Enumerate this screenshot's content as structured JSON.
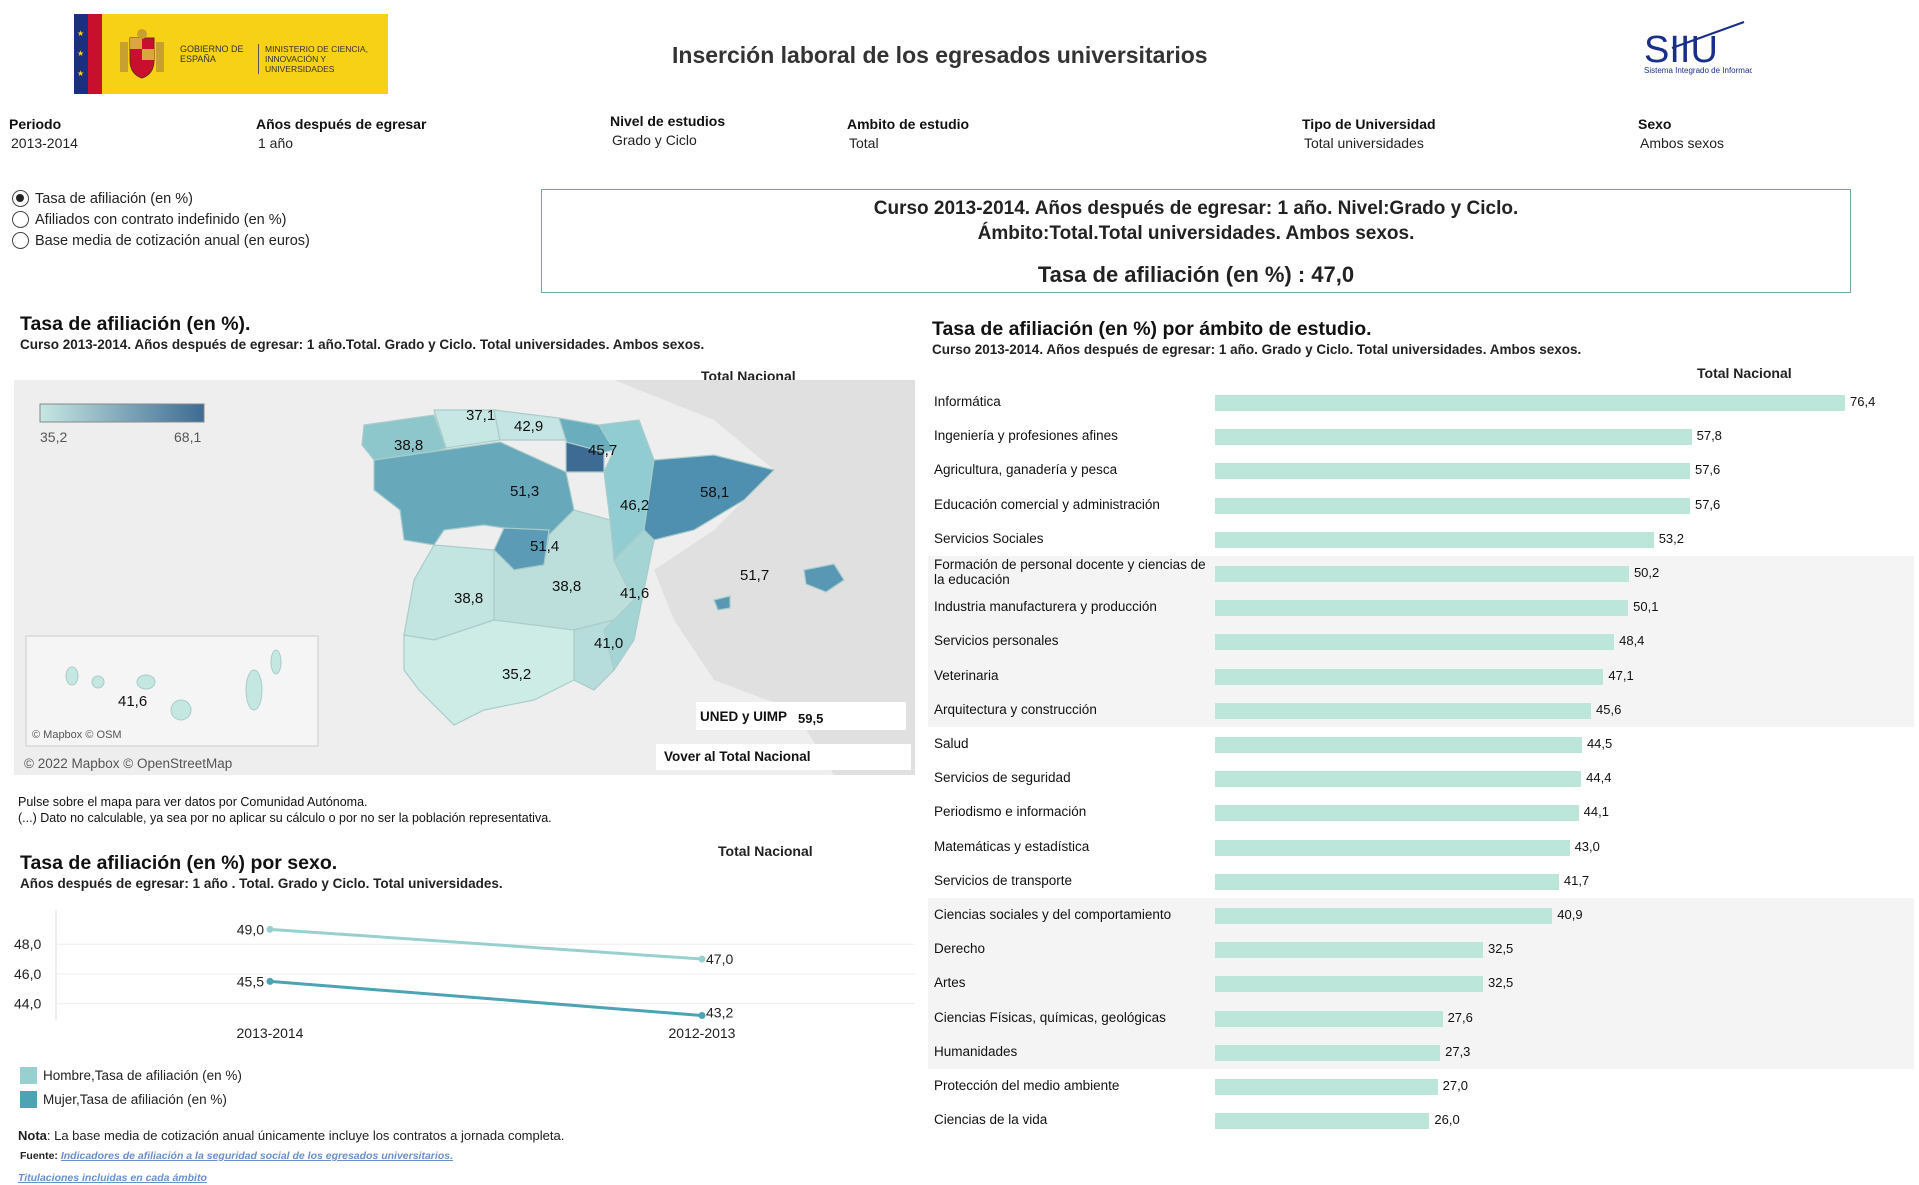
{
  "header": {
    "logo_gov_text": "GOBIERNO DE ESPAÑA",
    "logo_ministry_text": "MINISTERIO DE CIENCIA, INNOVACIÓN Y UNIVERSIDADES",
    "title": "Inserción laboral de los egresados universitarios",
    "siiu_logo": "SIIU",
    "siiu_sub": "Sistema Integrado de Información Universitaria"
  },
  "filters": [
    {
      "label": "Periodo",
      "value": "2013-2014"
    },
    {
      "label": "Años después de egresar",
      "value": "1 año"
    },
    {
      "label": "Nivel de estudios",
      "value": "Grado y Ciclo"
    },
    {
      "label": "Ambito de estudio",
      "value": "Total"
    },
    {
      "label": "Tipo de Universidad",
      "value": "Total universidades"
    },
    {
      "label": "Sexo",
      "value": "Ambos sexos"
    }
  ],
  "metric_options": [
    {
      "label": "Tasa de afiliación (en %)",
      "selected": true
    },
    {
      "label": "Afiliados con contrato indefinido (en %)",
      "selected": false
    },
    {
      "label": "Base media de cotización anual (en euros)",
      "selected": false
    }
  ],
  "summary": {
    "line1": "Curso 2013-2014. Años después de egresar: 1 año. Nivel:Grado y Ciclo.",
    "line2": "Ámbito:Total.Total universidades. Ambos sexos.",
    "line3": "Tasa de afiliación (en %) :  47,0"
  },
  "map_section": {
    "title": "Tasa de afiliación (en %).",
    "subtitle": "Curso 2013-2014. Años después de egresar: 1 año.Total. Grado y Ciclo. Total universidades. Ambos sexos.",
    "total_nacional": "Total Nacional",
    "legend_min": "35,2",
    "legend_max": "68,1",
    "mapbox_inset": "© Mapbox © OSM",
    "mapbox_credit": "© 2022 Mapbox © OpenStreetMap",
    "uned_label": "UNED y UIMP",
    "uned_value": "59,5",
    "volver": "Vover al Total Nacional",
    "region_values": [
      "37,1",
      "42,9",
      "38,8",
      "45,7",
      "51,3",
      "46,2",
      "58,1",
      "51,4",
      "38,8",
      "38,8",
      "41,6",
      "51,7",
      "41,0",
      "35,2",
      "41,6"
    ],
    "note1": "Pulse sobre el mapa para ver datos por Comunidad Autónoma.",
    "note2": "(...) Dato no calculable, ya sea por no aplicar su cálculo o por no ser la población representativa.",
    "colors": {
      "low": "#c6e7e3",
      "high": "#3d6b93"
    }
  },
  "sex_section": {
    "title": "Tasa de afiliación (en %) por sexo.",
    "subtitle": "Años después de egresar: 1 año . Total. Grado y Ciclo. Total universidades.",
    "total_nacional": "Total Nacional",
    "legend": [
      {
        "label": "Hombre,Tasa de afiliación (en %)",
        "color": "#98d0cf"
      },
      {
        "label": "Mujer,Tasa de afiliación (en %)",
        "color": "#4ba3b3"
      }
    ]
  },
  "chart_data": [
    {
      "type": "line",
      "categories": [
        "2013-2014",
        "2012-2013"
      ],
      "series": [
        {
          "name": "Hombre,Tasa de afiliación (en %)",
          "values": [
            49.0,
            47.0
          ],
          "labels": [
            "49,0",
            "47,0"
          ],
          "color": "#98d0cf"
        },
        {
          "name": "Mujer,Tasa de afiliación (en %)",
          "values": [
            45.5,
            43.2
          ],
          "labels": [
            "45,5",
            "43,2"
          ],
          "color": "#4ba3b3"
        }
      ],
      "y_ticks": [
        "48,0",
        "46,0",
        "44,0"
      ],
      "y_tick_values": [
        48,
        46,
        44
      ],
      "ylim": [
        42.9,
        50.3
      ],
      "grid": true
    },
    {
      "type": "bar",
      "orientation": "horizontal",
      "title": "Tasa de afiliación (en %) por ámbito de estudio.",
      "subtitle": "Curso 2013-2014. Años después de egresar: 1 año. Grado y Ciclo. Total universidades. Ambos sexos.",
      "total_nacional": "Total Nacional",
      "color": "#bde6da",
      "xlim": [
        0,
        76.4
      ],
      "categories": [
        "Informática",
        "Ingeniería y profesiones afines",
        "Agricultura, ganadería y pesca",
        "Educación comercial y administración",
        "Servicios Sociales",
        "Formación de personal docente y ciencias de la educación",
        "Industria manufacturera y producción",
        "Servicios personales",
        "Veterinaria",
        "Arquitectura y construcción",
        "Salud",
        "Servicios de seguridad",
        "Periodismo e información",
        "Matemáticas y estadística",
        "Servicios de transporte",
        "Ciencias sociales y del comportamiento",
        "Derecho",
        "Artes",
        "Ciencias Físicas, químicas, geológicas",
        "Humanidades",
        "Protección del medio ambiente",
        "Ciencias de la vida"
      ],
      "values": [
        76.4,
        57.8,
        57.6,
        57.6,
        53.2,
        50.2,
        50.1,
        48.4,
        47.1,
        45.6,
        44.5,
        44.4,
        44.1,
        43.0,
        41.7,
        40.9,
        32.5,
        32.5,
        27.6,
        27.3,
        27.0,
        26.0
      ],
      "labels": [
        "76,4",
        "57,8",
        "57,6",
        "57,6",
        "53,2",
        "50,2",
        "50,1",
        "48,4",
        "47,1",
        "45,6",
        "44,5",
        "44,4",
        "44,1",
        "43,0",
        "41,7",
        "40,9",
        "32,5",
        "32,5",
        "27,6",
        "27,3",
        "27,0",
        "26,0"
      ]
    }
  ],
  "footer": {
    "nota_label": "Nota",
    "nota_text": ": La base media de cotización anual únicamente incluye los contratos a jornada completa.",
    "fuente_label": "Fuente:",
    "fuente_link": "Indicadores de afiliación a la seguridad social de los egresados universitarios.",
    "titulaciones_link": "Titulaciones incluidas en cada ámbito"
  }
}
